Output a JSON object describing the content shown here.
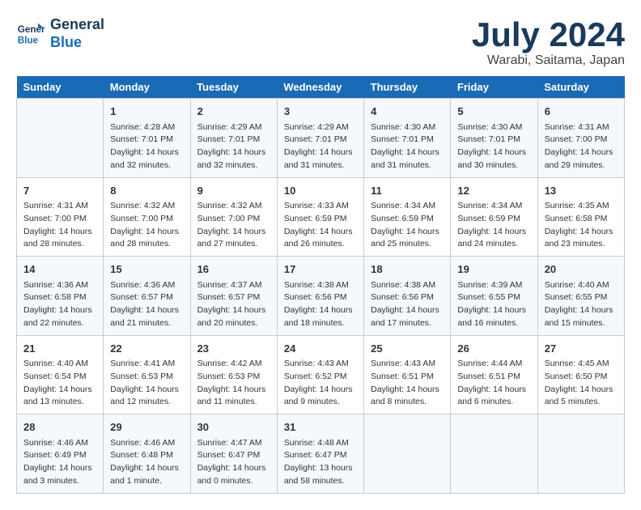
{
  "header": {
    "logo_line1": "General",
    "logo_line2": "Blue",
    "main_title": "July 2024",
    "subtitle": "Warabi, Saitama, Japan"
  },
  "days_of_week": [
    "Sunday",
    "Monday",
    "Tuesday",
    "Wednesday",
    "Thursday",
    "Friday",
    "Saturday"
  ],
  "weeks": [
    [
      {
        "day": "",
        "info": ""
      },
      {
        "day": "1",
        "info": "Sunrise: 4:28 AM\nSunset: 7:01 PM\nDaylight: 14 hours\nand 32 minutes."
      },
      {
        "day": "2",
        "info": "Sunrise: 4:29 AM\nSunset: 7:01 PM\nDaylight: 14 hours\nand 32 minutes."
      },
      {
        "day": "3",
        "info": "Sunrise: 4:29 AM\nSunset: 7:01 PM\nDaylight: 14 hours\nand 31 minutes."
      },
      {
        "day": "4",
        "info": "Sunrise: 4:30 AM\nSunset: 7:01 PM\nDaylight: 14 hours\nand 31 minutes."
      },
      {
        "day": "5",
        "info": "Sunrise: 4:30 AM\nSunset: 7:01 PM\nDaylight: 14 hours\nand 30 minutes."
      },
      {
        "day": "6",
        "info": "Sunrise: 4:31 AM\nSunset: 7:00 PM\nDaylight: 14 hours\nand 29 minutes."
      }
    ],
    [
      {
        "day": "7",
        "info": "Sunrise: 4:31 AM\nSunset: 7:00 PM\nDaylight: 14 hours\nand 28 minutes."
      },
      {
        "day": "8",
        "info": "Sunrise: 4:32 AM\nSunset: 7:00 PM\nDaylight: 14 hours\nand 28 minutes."
      },
      {
        "day": "9",
        "info": "Sunrise: 4:32 AM\nSunset: 7:00 PM\nDaylight: 14 hours\nand 27 minutes."
      },
      {
        "day": "10",
        "info": "Sunrise: 4:33 AM\nSunset: 6:59 PM\nDaylight: 14 hours\nand 26 minutes."
      },
      {
        "day": "11",
        "info": "Sunrise: 4:34 AM\nSunset: 6:59 PM\nDaylight: 14 hours\nand 25 minutes."
      },
      {
        "day": "12",
        "info": "Sunrise: 4:34 AM\nSunset: 6:59 PM\nDaylight: 14 hours\nand 24 minutes."
      },
      {
        "day": "13",
        "info": "Sunrise: 4:35 AM\nSunset: 6:58 PM\nDaylight: 14 hours\nand 23 minutes."
      }
    ],
    [
      {
        "day": "14",
        "info": "Sunrise: 4:36 AM\nSunset: 6:58 PM\nDaylight: 14 hours\nand 22 minutes."
      },
      {
        "day": "15",
        "info": "Sunrise: 4:36 AM\nSunset: 6:57 PM\nDaylight: 14 hours\nand 21 minutes."
      },
      {
        "day": "16",
        "info": "Sunrise: 4:37 AM\nSunset: 6:57 PM\nDaylight: 14 hours\nand 20 minutes."
      },
      {
        "day": "17",
        "info": "Sunrise: 4:38 AM\nSunset: 6:56 PM\nDaylight: 14 hours\nand 18 minutes."
      },
      {
        "day": "18",
        "info": "Sunrise: 4:38 AM\nSunset: 6:56 PM\nDaylight: 14 hours\nand 17 minutes."
      },
      {
        "day": "19",
        "info": "Sunrise: 4:39 AM\nSunset: 6:55 PM\nDaylight: 14 hours\nand 16 minutes."
      },
      {
        "day": "20",
        "info": "Sunrise: 4:40 AM\nSunset: 6:55 PM\nDaylight: 14 hours\nand 15 minutes."
      }
    ],
    [
      {
        "day": "21",
        "info": "Sunrise: 4:40 AM\nSunset: 6:54 PM\nDaylight: 14 hours\nand 13 minutes."
      },
      {
        "day": "22",
        "info": "Sunrise: 4:41 AM\nSunset: 6:53 PM\nDaylight: 14 hours\nand 12 minutes."
      },
      {
        "day": "23",
        "info": "Sunrise: 4:42 AM\nSunset: 6:53 PM\nDaylight: 14 hours\nand 11 minutes."
      },
      {
        "day": "24",
        "info": "Sunrise: 4:43 AM\nSunset: 6:52 PM\nDaylight: 14 hours\nand 9 minutes."
      },
      {
        "day": "25",
        "info": "Sunrise: 4:43 AM\nSunset: 6:51 PM\nDaylight: 14 hours\nand 8 minutes."
      },
      {
        "day": "26",
        "info": "Sunrise: 4:44 AM\nSunset: 6:51 PM\nDaylight: 14 hours\nand 6 minutes."
      },
      {
        "day": "27",
        "info": "Sunrise: 4:45 AM\nSunset: 6:50 PM\nDaylight: 14 hours\nand 5 minutes."
      }
    ],
    [
      {
        "day": "28",
        "info": "Sunrise: 4:46 AM\nSunset: 6:49 PM\nDaylight: 14 hours\nand 3 minutes."
      },
      {
        "day": "29",
        "info": "Sunrise: 4:46 AM\nSunset: 6:48 PM\nDaylight: 14 hours\nand 1 minute."
      },
      {
        "day": "30",
        "info": "Sunrise: 4:47 AM\nSunset: 6:47 PM\nDaylight: 14 hours\nand 0 minutes."
      },
      {
        "day": "31",
        "info": "Sunrise: 4:48 AM\nSunset: 6:47 PM\nDaylight: 13 hours\nand 58 minutes."
      },
      {
        "day": "",
        "info": ""
      },
      {
        "day": "",
        "info": ""
      },
      {
        "day": "",
        "info": ""
      }
    ]
  ]
}
